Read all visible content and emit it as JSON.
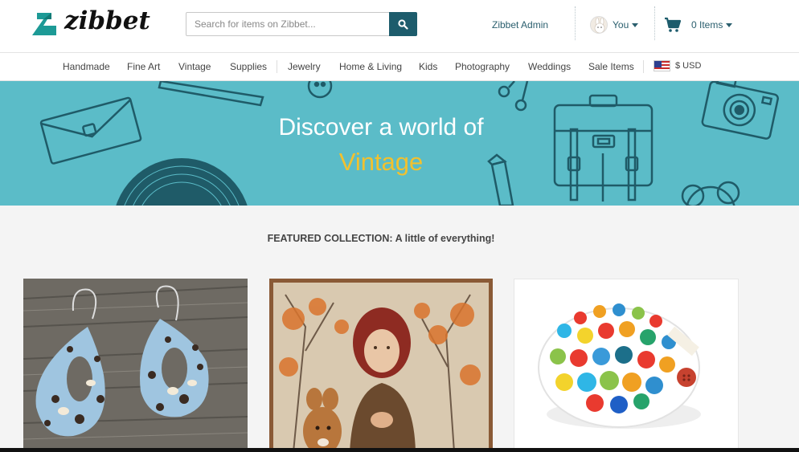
{
  "brand": {
    "name": "zibbet",
    "logo_color": "#1d9a96"
  },
  "search": {
    "placeholder": "Search for items on Zibbet..."
  },
  "header": {
    "admin_link": "Zibbet Admin",
    "user_label": "You",
    "cart_label": "0 Items"
  },
  "nav": {
    "items": [
      "Handmade",
      "Fine Art",
      "Vintage",
      "Supplies",
      "Jewelry",
      "Home & Living",
      "Kids",
      "Photography",
      "Weddings",
      "Sale Items"
    ],
    "currency": "$ USD"
  },
  "banner": {
    "line1": "Discover a world of",
    "line2": "Vintage",
    "bg_color": "#5bbcc8",
    "accent_color": "#f1c12f"
  },
  "featured": {
    "title": "FEATURED COLLECTION: A little of everything!",
    "products": [
      {
        "image": "leather-earrings-photo"
      },
      {
        "image": "vintage-girl-with-fawn-painting"
      },
      {
        "image": "polka-dot-tape-measure-photo"
      }
    ]
  },
  "colors": {
    "accent_dark": "#1d5c6c",
    "link": "#2b5f6e"
  }
}
